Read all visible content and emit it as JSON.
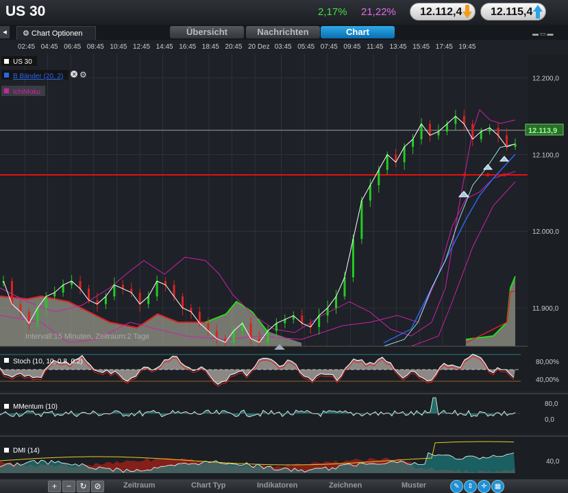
{
  "header": {
    "title": "US 30",
    "change_pct": "2,17%",
    "volatility_pct": "21,22%",
    "bid": "12.112,4",
    "ask": "12.115,4"
  },
  "tabs": {
    "chart_options": "Chart Optionen",
    "items": [
      "Übersicht",
      "Nachrichten",
      "Chart"
    ],
    "active": "Chart"
  },
  "time_axis": [
    "02:45",
    "04:45",
    "06:45",
    "08:45",
    "10:45",
    "12:45",
    "14:45",
    "16:45",
    "18:45",
    "20:45",
    "20 Dez",
    "03:45",
    "05:45",
    "07:45",
    "09:45",
    "11:45",
    "13:45",
    "15:45",
    "17:45",
    "19:45"
  ],
  "legend": {
    "instrument": "US 30",
    "bbands": "B Bänder (20, 2)",
    "ichimoku": "IchiMoku"
  },
  "price_axis": [
    "12.200,0",
    "12.100,0",
    "12.000,0",
    "11.900,0"
  ],
  "current_price_label": "12.113,9",
  "interval_text": "Intervall:15 Minuten, Zeitraum:2 Tage",
  "indicators": {
    "stoch": {
      "label": "Stoch (10, 10, 0.8, 0.2)",
      "levels": [
        "80,00%",
        "40,00%"
      ]
    },
    "momentum": {
      "label": "MMentum (10)",
      "levels": [
        "80,0",
        "0,0"
      ]
    },
    "dmi": {
      "label": "DMI (14)",
      "levels": [
        "40,0"
      ]
    }
  },
  "bottom_menu": [
    "Zeitraum",
    "Chart Typ",
    "Indikatoren",
    "Zeichnen",
    "Muster"
  ],
  "colors": {
    "up": "#22cc22",
    "down": "#dd2222",
    "bband": "#2255dd",
    "ichimoku": "#cc22aa",
    "price_line": "#ffffff",
    "accent": "#1a8fe0"
  },
  "chart_data": {
    "type": "line",
    "x_range": [
      "19 Dez 02:45",
      "20 Dez 19:45"
    ],
    "ylim": [
      11850,
      12230
    ],
    "price_close": [
      11935,
      11905,
      11895,
      11880,
      11900,
      11915,
      11920,
      11930,
      11935,
      11925,
      11910,
      11905,
      11915,
      11930,
      11925,
      11920,
      11905,
      11915,
      11935,
      11930,
      11915,
      11900,
      11895,
      11880,
      11870,
      11860,
      11855,
      11870,
      11880,
      11860,
      11855,
      11870,
      11880,
      11885,
      11890,
      11880,
      11875,
      11890,
      11900,
      11915,
      11940,
      11990,
      12040,
      12060,
      12080,
      12100,
      12090,
      12110,
      12120,
      12140,
      12125,
      12130,
      12140,
      12150,
      12140,
      12120,
      12130,
      12135,
      12125,
      12110,
      12113.9
    ],
    "reference_line": 12113.9,
    "support_line": 12085
  }
}
